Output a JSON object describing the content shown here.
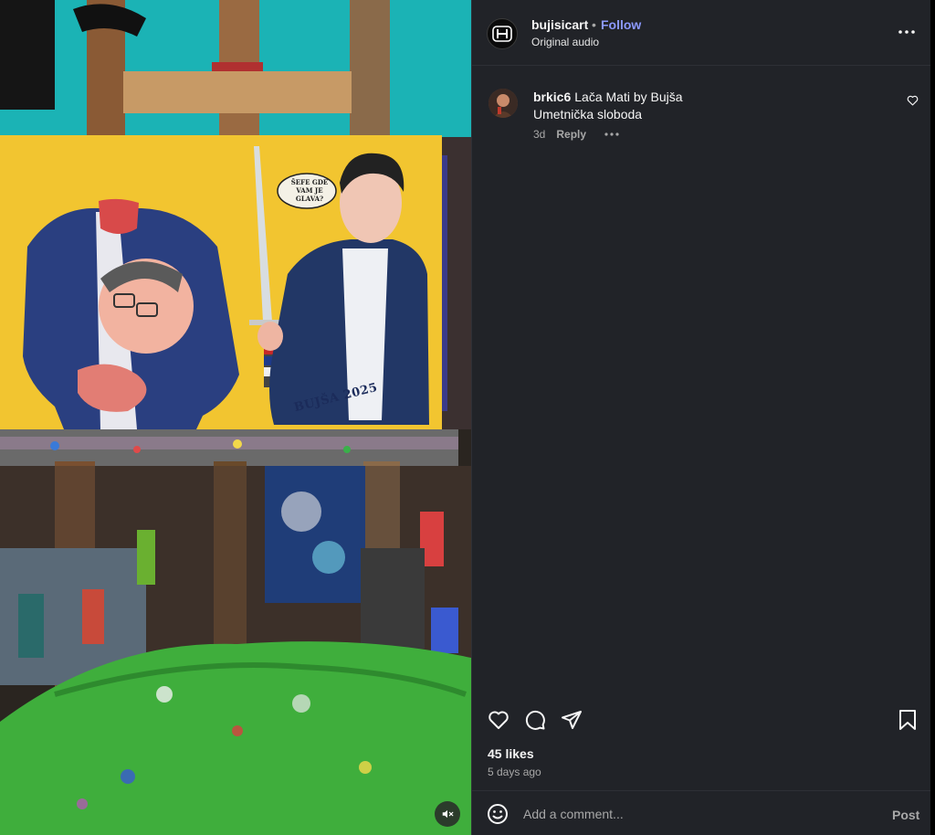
{
  "post": {
    "username": "bujisicart",
    "separator": "•",
    "follow_label": "Follow",
    "audio_label": "Original audio",
    "more_icon": "more-horizontal-icon",
    "avatar_icon": "honda-logo-icon"
  },
  "comments": [
    {
      "username": "brkic6",
      "line1": "Lača Mati by Bujša",
      "line2": "Umetnička sloboda",
      "time": "3d",
      "reply_label": "Reply"
    }
  ],
  "media": {
    "speech_bubble_text": "ŠEFE GDE VAM JE GLAVA?",
    "signature_text": "BUJŠA 2025",
    "mute_icon": "speaker-muted-icon"
  },
  "actions": {
    "icons": [
      "heart-icon",
      "comment-icon",
      "share-icon",
      "bookmark-icon"
    ]
  },
  "likes_label": "45 likes",
  "posted_ago": "5 days ago",
  "comment_box": {
    "placeholder": "Add a comment...",
    "post_label": "Post",
    "emoji_icon": "emoji-icon"
  },
  "colors": {
    "panel_bg": "#212328",
    "follow_blue": "#8c99ff",
    "painting_yellow": "#f2c530",
    "cloth_green": "#3fae3c"
  }
}
